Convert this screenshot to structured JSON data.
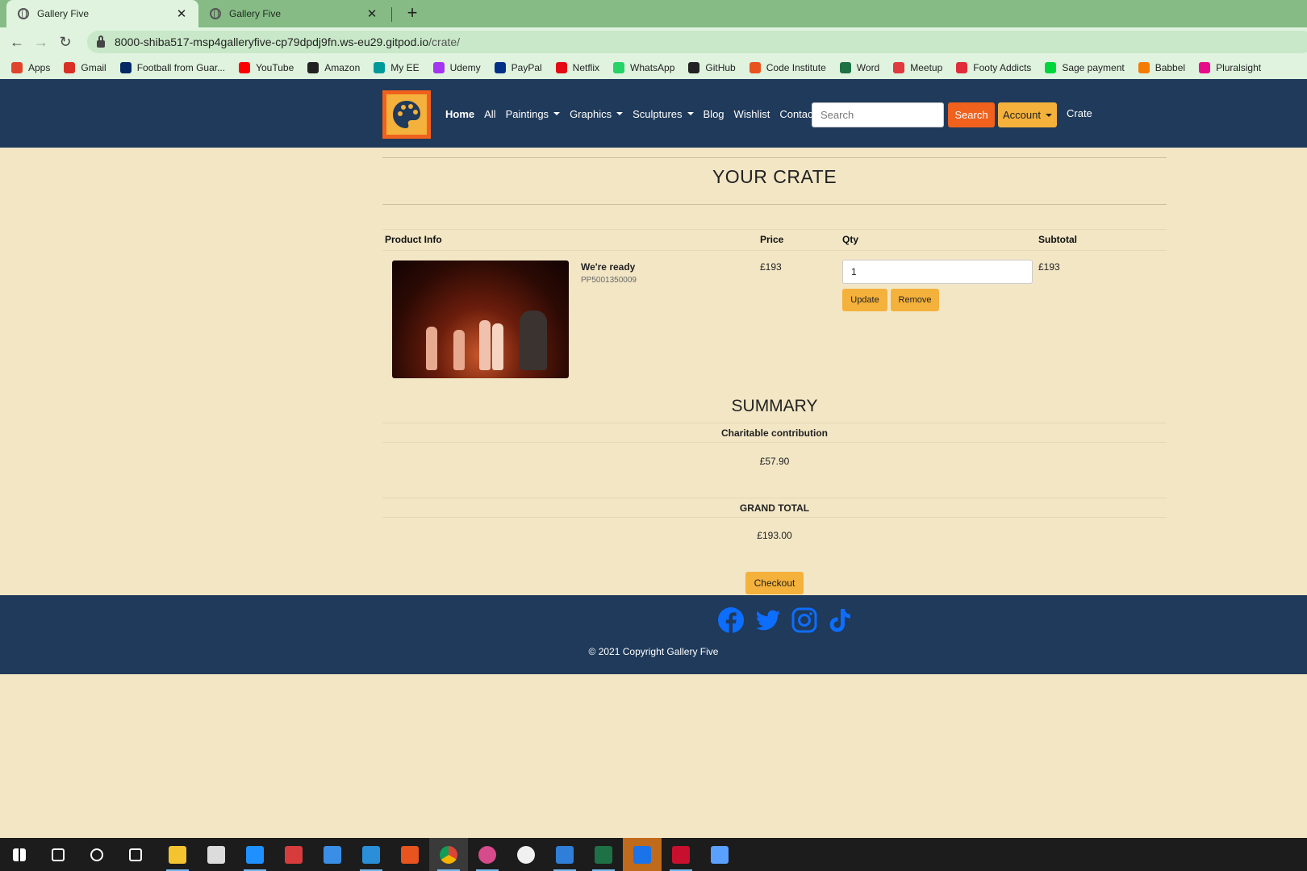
{
  "browser": {
    "tabs": [
      {
        "title": "Gallery Five",
        "active": true
      },
      {
        "title": "Gallery Five",
        "active": false
      }
    ],
    "url_host": "8000-shiba517-msp4galleryfive-cp79dpdj9fn.ws-eu29.gitpod.io",
    "url_path": "/crate/",
    "bookmarks": [
      {
        "label": "Apps",
        "icon": "apps-grid-icon",
        "color": "#e0442c"
      },
      {
        "label": "Gmail",
        "icon": "gmail-icon",
        "color": "#d93025"
      },
      {
        "label": "Football from Guar...",
        "icon": "guardian-icon",
        "color": "#052962"
      },
      {
        "label": "YouTube",
        "icon": "youtube-icon",
        "color": "#ff0000"
      },
      {
        "label": "Amazon",
        "icon": "amazon-icon",
        "color": "#222222"
      },
      {
        "label": "My EE",
        "icon": "ee-icon",
        "color": "#009a9a"
      },
      {
        "label": "Udemy",
        "icon": "udemy-icon",
        "color": "#a435f0"
      },
      {
        "label": "PayPal",
        "icon": "paypal-icon",
        "color": "#003087"
      },
      {
        "label": "Netflix",
        "icon": "netflix-icon",
        "color": "#e50914"
      },
      {
        "label": "WhatsApp",
        "icon": "whatsapp-icon",
        "color": "#25d366"
      },
      {
        "label": "GitHub",
        "icon": "github-icon",
        "color": "#222222"
      },
      {
        "label": "Code Institute",
        "icon": "code-institute-icon",
        "color": "#e8541e"
      },
      {
        "label": "Word",
        "icon": "word-icon",
        "color": "#1e7145"
      },
      {
        "label": "Meetup",
        "icon": "meetup-icon",
        "color": "#e0393e"
      },
      {
        "label": "Footy Addicts",
        "icon": "footy-addicts-icon",
        "color": "#e02b3b"
      },
      {
        "label": "Sage payment",
        "icon": "sage-icon",
        "color": "#00d639"
      },
      {
        "label": "Babbel",
        "icon": "babbel-icon",
        "color": "#f57c00"
      },
      {
        "label": "Pluralsight",
        "icon": "pluralsight-icon",
        "color": "#e80a89"
      }
    ]
  },
  "nav": {
    "items": [
      {
        "label": "Home",
        "active": true,
        "dropdown": false
      },
      {
        "label": "All",
        "active": false,
        "dropdown": false
      },
      {
        "label": "Paintings",
        "active": false,
        "dropdown": true
      },
      {
        "label": "Graphics",
        "active": false,
        "dropdown": true
      },
      {
        "label": "Sculptures",
        "active": false,
        "dropdown": true
      },
      {
        "label": "Blog",
        "active": false,
        "dropdown": false
      },
      {
        "label": "Wishlist",
        "active": false,
        "dropdown": false
      },
      {
        "label": "Contact",
        "active": false,
        "dropdown": false
      }
    ],
    "search_placeholder": "Search",
    "search_button": "Search",
    "account_label": "Account",
    "crate_label": "Crate"
  },
  "page": {
    "title": "YOUR CRATE",
    "table_headers": {
      "product": "Product Info",
      "price": "Price",
      "qty": "Qty",
      "subtotal": "Subtotal"
    },
    "items": [
      {
        "name": "We're ready",
        "sku": "PP5001350009",
        "price": "£193",
        "qty": "1",
        "subtotal": "£193",
        "update_label": "Update",
        "remove_label": "Remove"
      }
    ],
    "summary": {
      "title": "SUMMARY",
      "charity_label": "Charitable contribution",
      "charity_value": "£57.90",
      "grand_total_label": "GRAND TOTAL",
      "grand_total_value": "£193.00"
    },
    "checkout_label": "Checkout"
  },
  "footer": {
    "social_icons": [
      "facebook-icon",
      "twitter-icon",
      "instagram-icon",
      "tiktok-icon"
    ],
    "copyright": "© 2021 Copyright Gallery Five"
  },
  "colors": {
    "background": "#f2e6c5",
    "navbar": "#1f3a5a",
    "accent_orange": "#f0611d",
    "accent_yellow": "#f4b13b",
    "social_blue": "#0d6efd"
  },
  "taskbar": {
    "icons": [
      "windows-start-icon",
      "search-icon",
      "cortana-icon",
      "task-view-icon",
      "file-explorer-icon",
      "store-icon",
      "edge-icon",
      "gift-icon",
      "mail-icon",
      "vscode-icon",
      "office-icon",
      "chrome-icon",
      "slack-icon",
      "emoji-app-icon",
      "photos-icon",
      "excel-icon",
      "security-icon",
      "mcafee-icon",
      "paint-drop-icon"
    ]
  }
}
